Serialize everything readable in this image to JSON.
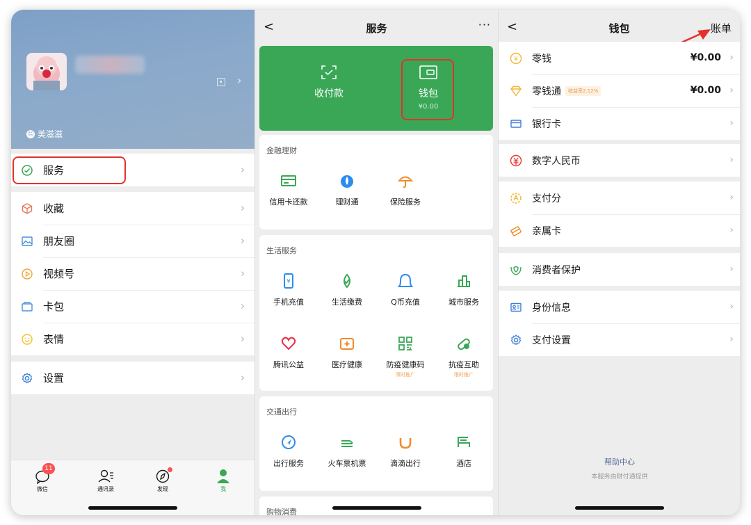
{
  "me_panel": {
    "status_text": "美滋滋",
    "menu": {
      "services": "服务",
      "favorites": "收藏",
      "moments": "朋友圈",
      "channels": "视频号",
      "cards": "卡包",
      "stickers": "表情",
      "settings": "设置"
    },
    "tabbar": {
      "chats": "微信",
      "chats_badge": "11",
      "contacts": "通讯录",
      "discover": "发现",
      "me": "我"
    }
  },
  "services_panel": {
    "title": "服务",
    "more": "···",
    "back": "<",
    "green_bar": {
      "pay_label": "收付款",
      "wallet_label": "钱包",
      "wallet_balance": "¥0.00"
    },
    "sections": [
      {
        "title": "金融理财",
        "items": [
          "信用卡还款",
          "理财通",
          "保险服务"
        ]
      },
      {
        "title": "生活服务",
        "items": [
          "手机充值",
          "生活缴费",
          "Q币充值",
          "城市服务",
          "腾讯公益",
          "医疗健康",
          "防疫健康码",
          "抗疫互助"
        ],
        "tags": [
          "限时推广",
          "限时推广"
        ]
      },
      {
        "title": "交通出行",
        "items": [
          "出行服务",
          "火车票机票",
          "滴滴出行",
          "酒店"
        ]
      },
      {
        "title": "购物消费"
      }
    ]
  },
  "wallet_panel": {
    "title": "钱包",
    "back": "<",
    "bill": "账单",
    "items": {
      "change": "零钱",
      "change_value": "¥0.00",
      "licaitong": "零钱通",
      "licaitong_pill": "收益率2.12%",
      "licaitong_value": "¥0.00",
      "bank_card": "银行卡",
      "ecny": "数字人民币",
      "pay_score": "支付分",
      "family_card": "亲属卡",
      "consumer_protection": "消费者保护",
      "identity": "身份信息",
      "pay_settings": "支付设置"
    },
    "help_center": "帮助中心",
    "help_note": "本服务由财付通提供"
  },
  "colors": {
    "wechat_green": "#3aa757",
    "highlight_red": "#e4312b",
    "link_blue": "#576b95",
    "background": "#ededed"
  }
}
